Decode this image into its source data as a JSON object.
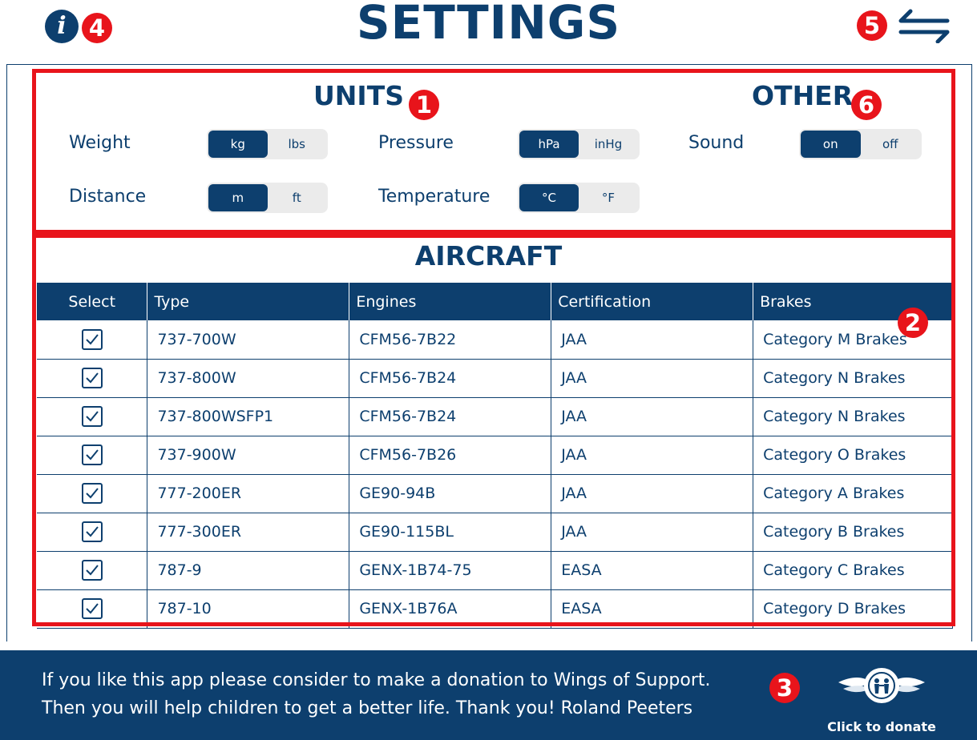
{
  "header": {
    "title": "SETTINGS",
    "info_badge": "4",
    "switch_badge": "5"
  },
  "units": {
    "title": "UNITS",
    "badge": "1",
    "weight": {
      "label": "Weight",
      "options": [
        "kg",
        "lbs"
      ],
      "selected": "kg"
    },
    "distance": {
      "label": "Distance",
      "options": [
        "m",
        "ft"
      ],
      "selected": "m"
    },
    "pressure": {
      "label": "Pressure",
      "options": [
        "hPa",
        "inHg"
      ],
      "selected": "hPa"
    },
    "temperature": {
      "label": "Temperature",
      "options": [
        "°C",
        "°F"
      ],
      "selected": "°C"
    }
  },
  "other": {
    "title": "OTHER",
    "badge": "6",
    "sound": {
      "label": "Sound",
      "options": [
        "on",
        "off"
      ],
      "selected": "on"
    }
  },
  "aircraft": {
    "title": "AIRCRAFT",
    "badge": "2",
    "columns": [
      "Select",
      "Type",
      "Engines",
      "Certification",
      "Brakes"
    ],
    "rows": [
      {
        "selected": true,
        "type": "737-700W",
        "engines": "CFM56-7B22",
        "certification": "JAA",
        "brakes": "Category M Brakes"
      },
      {
        "selected": true,
        "type": "737-800W",
        "engines": "CFM56-7B24",
        "certification": "JAA",
        "brakes": "Category N Brakes"
      },
      {
        "selected": true,
        "type": "737-800WSFP1",
        "engines": "CFM56-7B24",
        "certification": "JAA",
        "brakes": "Category N Brakes"
      },
      {
        "selected": true,
        "type": "737-900W",
        "engines": "CFM56-7B26",
        "certification": "JAA",
        "brakes": "Category O Brakes"
      },
      {
        "selected": true,
        "type": "777-200ER",
        "engines": "GE90-94B",
        "certification": "JAA",
        "brakes": "Category A Brakes"
      },
      {
        "selected": true,
        "type": "777-300ER",
        "engines": "GE90-115BL",
        "certification": "JAA",
        "brakes": "Category B Brakes"
      },
      {
        "selected": true,
        "type": "787-9",
        "engines": "GENX-1B74-75",
        "certification": "EASA",
        "brakes": "Category C Brakes"
      },
      {
        "selected": true,
        "type": "787-10",
        "engines": "GENX-1B76A",
        "certification": "EASA",
        "brakes": "Category D Brakes"
      }
    ]
  },
  "footer": {
    "line1": "If you like this app please consider to make a donation to Wings of Support.",
    "line2": "Then you will help children to get a better life. Thank you!   Roland Peeters",
    "badge": "3",
    "donate_label": "Click to donate"
  },
  "colors": {
    "brand_navy": "#0d3f6e",
    "annotation_red": "#e8141b",
    "segment_bg": "#ebebeb"
  },
  "icons": {
    "info": "info-icon",
    "switch": "swap-arrows-icon",
    "checkbox": "checkbox-checked-icon",
    "donate_logo": "wings-of-support-logo"
  }
}
